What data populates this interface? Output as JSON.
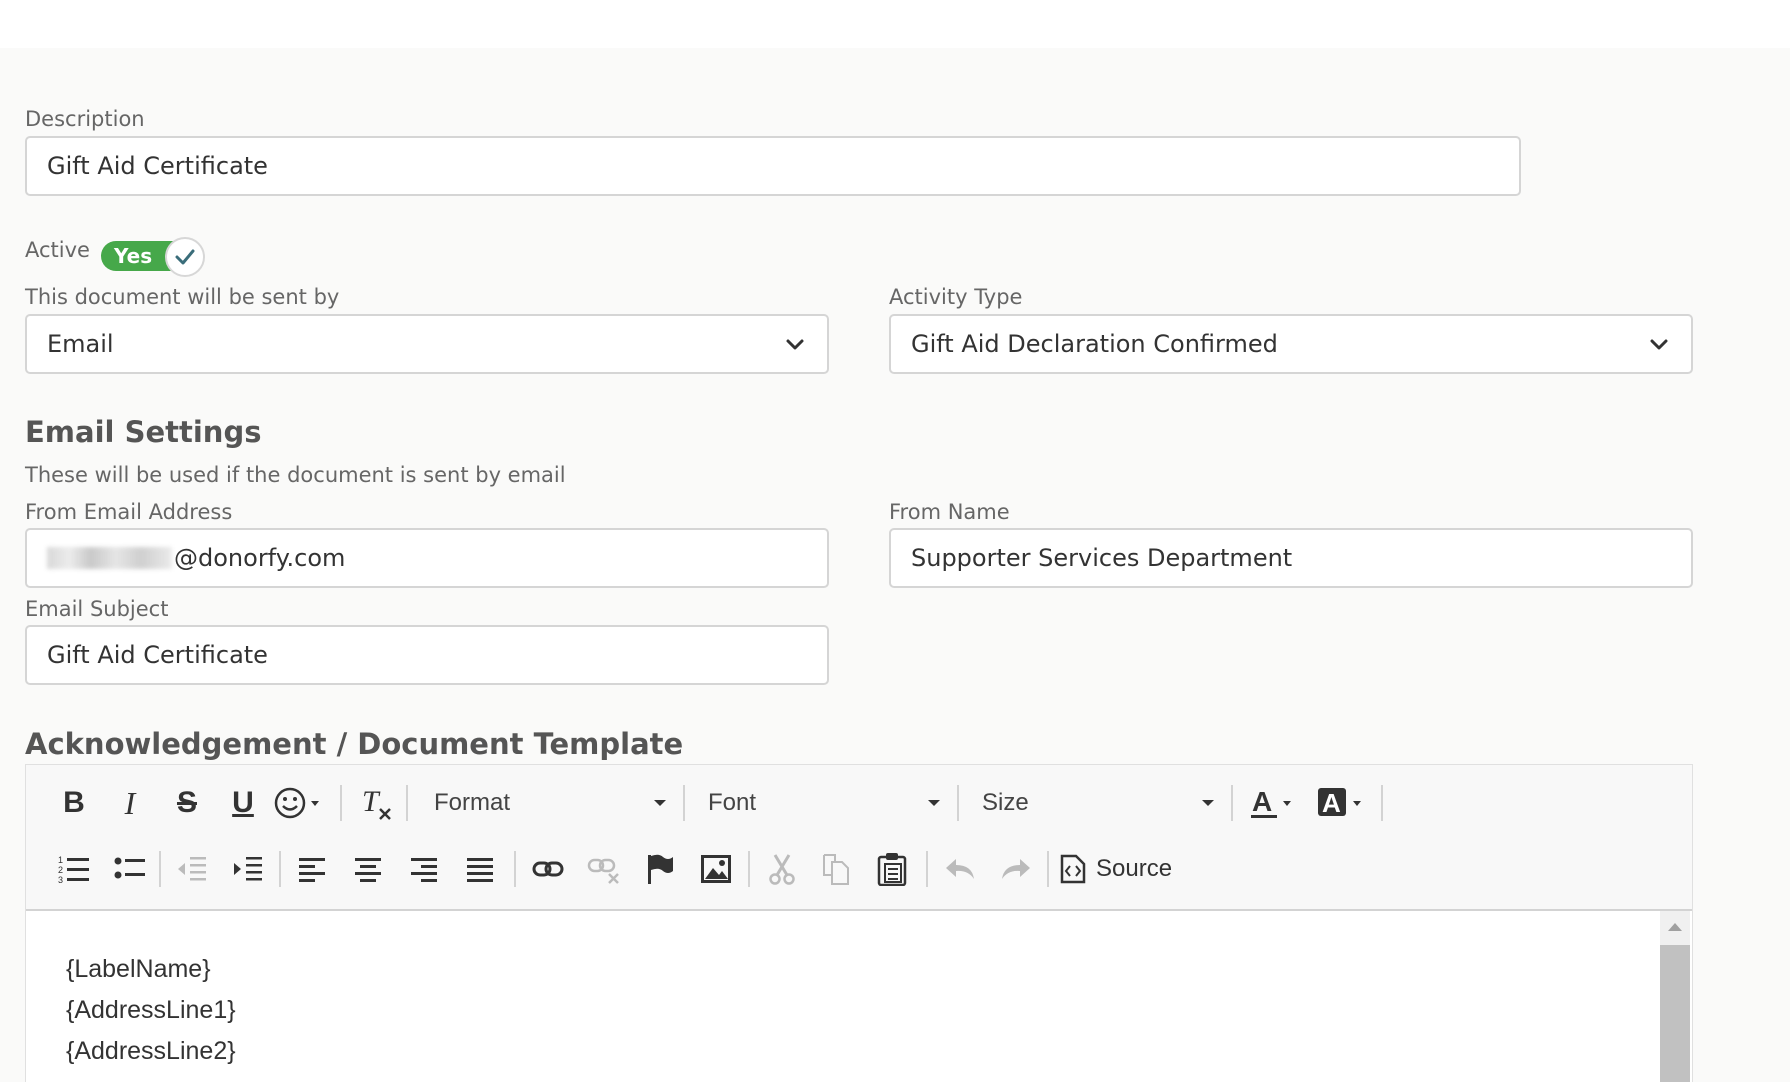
{
  "form": {
    "description": {
      "label": "Description",
      "value": "Gift Aid Certificate"
    },
    "active": {
      "label": "Active",
      "toggle_text": "Yes"
    },
    "sent_by": {
      "label": "This document will be sent by",
      "value": "Email"
    },
    "activity_type": {
      "label": "Activity Type",
      "value": "Gift Aid Declaration Confirmed"
    }
  },
  "email_settings": {
    "heading": "Email Settings",
    "subtext": "These will be used if the document is sent by email",
    "from_email": {
      "label": "From Email Address",
      "value_visible": "@donorfy.com"
    },
    "from_name": {
      "label": "From Name",
      "value": "Supporter Services Department"
    },
    "subject": {
      "label": "Email Subject",
      "value": "Gift Aid Certificate"
    }
  },
  "template": {
    "heading": "Acknowledgement / Document Template",
    "toolbar": {
      "format_label": "Format",
      "font_label": "Font",
      "size_label": "Size",
      "source_label": "Source",
      "row1_icons": [
        "bold-icon",
        "italic-icon",
        "strikethrough-icon",
        "underline-icon",
        "emoji-icon",
        "remove-format-icon",
        "text-color-icon",
        "background-color-icon"
      ],
      "row2_icons": [
        "numbered-list-icon",
        "bulleted-list-icon",
        "outdent-icon",
        "indent-icon",
        "align-left-icon",
        "align-center-icon",
        "align-right-icon",
        "justify-icon",
        "link-icon",
        "unlink-icon",
        "anchor-flag-icon",
        "image-icon",
        "cut-icon",
        "copy-icon",
        "paste-icon",
        "undo-icon",
        "redo-icon",
        "source-icon"
      ]
    },
    "content_lines": [
      "{LabelName}",
      "{AddressLine1}",
      "{AddressLine2}"
    ]
  },
  "colors": {
    "toggle_on": "#46a84a",
    "heading": "#555555",
    "field_border": "#d5d5d5"
  }
}
